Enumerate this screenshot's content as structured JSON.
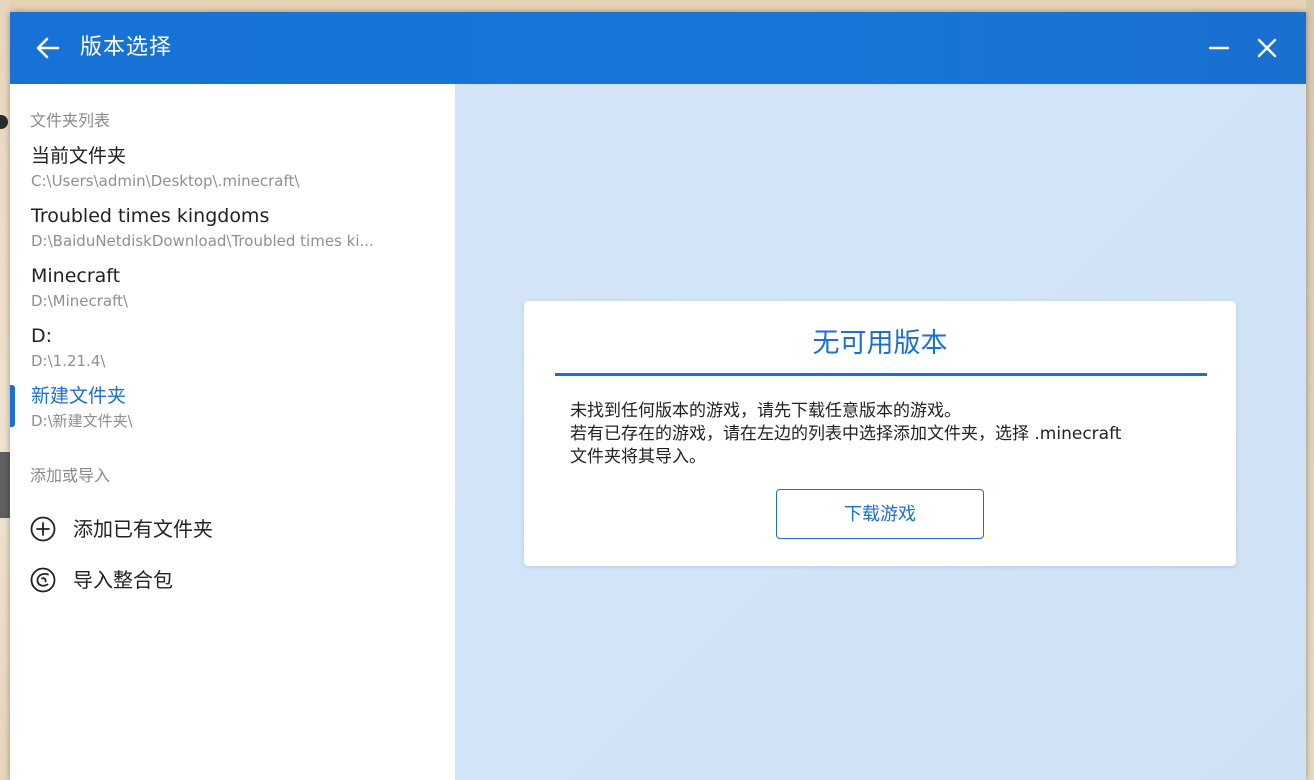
{
  "window": {
    "title": "版本选择",
    "colors": {
      "titlebar": "#1771d6",
      "accent": "#1b6fd1",
      "main_background": "#d3e5f6"
    }
  },
  "sidebar": {
    "folder_section_title": "文件夹列表",
    "folders": [
      {
        "name": "当前文件夹",
        "path": "C:\\Users\\admin\\Desktop\\.minecraft\\",
        "selected": false
      },
      {
        "name": "Troubled times kingdoms",
        "path": "D:\\BaiduNetdiskDownload\\Troubled times ki...",
        "selected": false
      },
      {
        "name": "Minecraft",
        "path": "D:\\Minecraft\\",
        "selected": false
      },
      {
        "name": "D:",
        "path": "D:\\1.21.4\\",
        "selected": false
      },
      {
        "name": "新建文件夹",
        "path": "D:\\新建文件夹\\",
        "selected": true
      }
    ],
    "add_section_title": "添加或导入",
    "actions": [
      {
        "label": "添加已有文件夹",
        "icon": "add-circle-icon"
      },
      {
        "label": "导入整合包",
        "icon": "import-package-icon"
      }
    ]
  },
  "main": {
    "card": {
      "title": "无可用版本",
      "message_lines": [
        "未找到任何版本的游戏，请先下载任意版本的游戏。",
        "若有已存在的游戏，请在左边的列表中选择添加文件夹，选择 .minecraft",
        "文件夹将其导入。"
      ],
      "button_label": "下载游戏"
    }
  }
}
